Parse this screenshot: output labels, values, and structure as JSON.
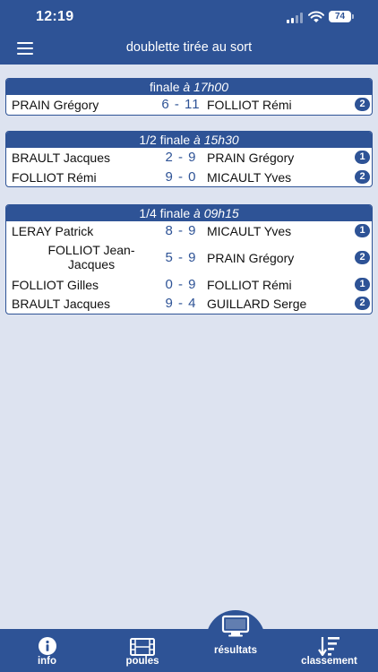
{
  "status": {
    "time": "12:19",
    "battery": "74"
  },
  "header": {
    "title": "doublette tirée au sort"
  },
  "sections": [
    {
      "title_prefix": "finale",
      "title_time": "à 17h00",
      "matches": [
        {
          "left": "PRAIN Grégory",
          "score": "6 - 11",
          "right": "FOLLIOT Rémi",
          "badge": "2"
        }
      ]
    },
    {
      "title_prefix": "1/2 finale",
      "title_time": "à 15h30",
      "matches": [
        {
          "left": "BRAULT Jacques",
          "score": "2 - 9",
          "right": "PRAIN Grégory",
          "badge": "1"
        },
        {
          "left": "FOLLIOT Rémi",
          "score": "9 - 0",
          "right": "MICAULT Yves",
          "badge": "2"
        }
      ]
    },
    {
      "title_prefix": "1/4 finale",
      "title_time": "à 09h15",
      "matches": [
        {
          "left": "LERAY Patrick",
          "score": "8 - 9",
          "right": "MICAULT Yves",
          "badge": "1"
        },
        {
          "left": "FOLLIOT Jean-Jacques",
          "score": "5 - 9",
          "right": "PRAIN Grégory",
          "badge": "2"
        },
        {
          "left": "FOLLIOT Gilles",
          "score": "0 - 9",
          "right": "FOLLIOT Rémi",
          "badge": "1"
        },
        {
          "left": "BRAULT Jacques",
          "score": "9 - 4",
          "right": "GUILLARD Serge",
          "badge": "2"
        }
      ]
    }
  ],
  "tabs": [
    {
      "label": "info",
      "icon": "info-icon"
    },
    {
      "label": "poules",
      "icon": "film-icon"
    },
    {
      "label": "résultats",
      "icon": "monitor-icon"
    },
    {
      "label": "classement",
      "icon": "sort-icon"
    }
  ],
  "colors": {
    "primary": "#2e5396",
    "background": "#dde3f0"
  }
}
